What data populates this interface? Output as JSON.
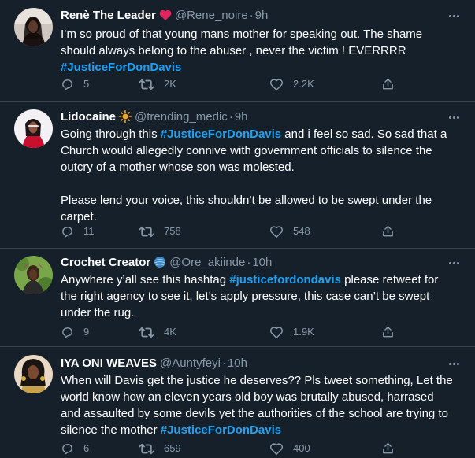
{
  "colors": {
    "background": "#15202b",
    "divider": "#38444d",
    "secondary_text": "#8899a6",
    "hashtag": "#1da1f2",
    "heart_badge": "#e0245e"
  },
  "tweets": [
    {
      "name": "Renè The Leader",
      "badge_icon": "red-heart",
      "handle": "@Rene_noire",
      "time": "9h",
      "lines": [
        {
          "text": "I’m so proud of that young mans mother for speaking out. The shame"
        },
        {
          "text": "should always belong to the abuser , never the victim ! EVERRRR"
        },
        {
          "tag": "#JusticeForDonDavis"
        }
      ],
      "replies": "5",
      "retweets": "2K",
      "likes": "2.2K"
    },
    {
      "name": "Lidocaine",
      "badge_icon": "sun",
      "handle": "@trending_medic",
      "time": "9h",
      "lines": [
        {
          "text": "Going through this ",
          "tag": "#JusticeForDonDavis",
          "after": " and i feel so sad. So sad that a"
        },
        {
          "text": "Church would allegedly connive with government officials to silence the"
        },
        {
          "text": "outcry of a mother whose son was molested."
        },
        {
          "text": ""
        },
        {
          "text": "Please lend your voice, this shouldn’t be allowed to be swept under the"
        },
        {
          "text": "carpet."
        }
      ],
      "replies": "11",
      "retweets": "758",
      "likes": "548"
    },
    {
      "name": "Crochet Creator",
      "badge_icon": "yarn-ball",
      "handle": "@Ore_akiinde",
      "time": "10h",
      "lines": [
        {
          "text": "Anywhere y’all see this hashtag ",
          "tag": "#justicefordondavis",
          "after": " please retweet for"
        },
        {
          "text": "the right agency to see it, let’s apply pressure, this case can’t be swept"
        },
        {
          "text": "under the rug."
        }
      ],
      "replies": "9",
      "retweets": "4K",
      "likes": "1.9K"
    },
    {
      "name": "IYA ONI WEAVES",
      "handle": "@Auntyfeyi",
      "time": "10h",
      "lines": [
        {
          "text": "When will Davis get the justice he deserves?? Pls tweet something, Let the"
        },
        {
          "text": "world know how an eleven years old boy was brutally abused, harrased"
        },
        {
          "text": "and assaulted by some devils yet the authorities of the school are trying to"
        },
        {
          "text": "silence the mother ",
          "tag": "#JusticeForDonDavis"
        }
      ],
      "replies": "6",
      "retweets": "659",
      "likes": "400"
    }
  ]
}
